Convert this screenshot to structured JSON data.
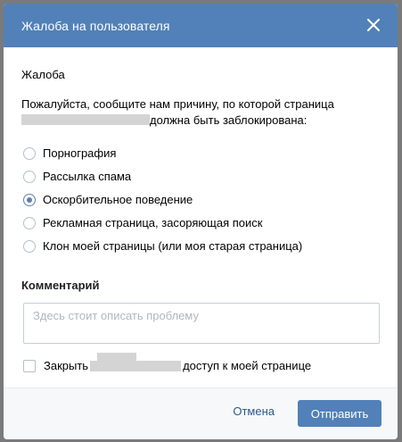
{
  "dialog": {
    "title": "Жалоба на пользователя"
  },
  "complaint": {
    "section_title": "Жалоба",
    "intro_before": "Пожалуйста, сообщите нам причину, по которой страница",
    "intro_after": "должна быть заблокирована:",
    "options": [
      {
        "label": "Порнография",
        "checked": false
      },
      {
        "label": "Рассылка спама",
        "checked": false
      },
      {
        "label": "Оскорбительное поведение",
        "checked": true
      },
      {
        "label": "Рекламная страница, засоряющая поиск",
        "checked": false
      },
      {
        "label": "Клон моей страницы (или моя старая страница)",
        "checked": false
      }
    ]
  },
  "comment": {
    "title": "Комментарий",
    "placeholder": "Здесь стоит описать проблему",
    "value": ""
  },
  "close_access": {
    "label_before": "Закрыть",
    "label_after": "доступ к моей странице",
    "checked": false
  },
  "footer": {
    "cancel_label": "Отмена",
    "submit_label": "Отправить"
  },
  "colors": {
    "header": "#5181b8",
    "link": "#2a5885",
    "radio_checked": "#5e81a8"
  }
}
